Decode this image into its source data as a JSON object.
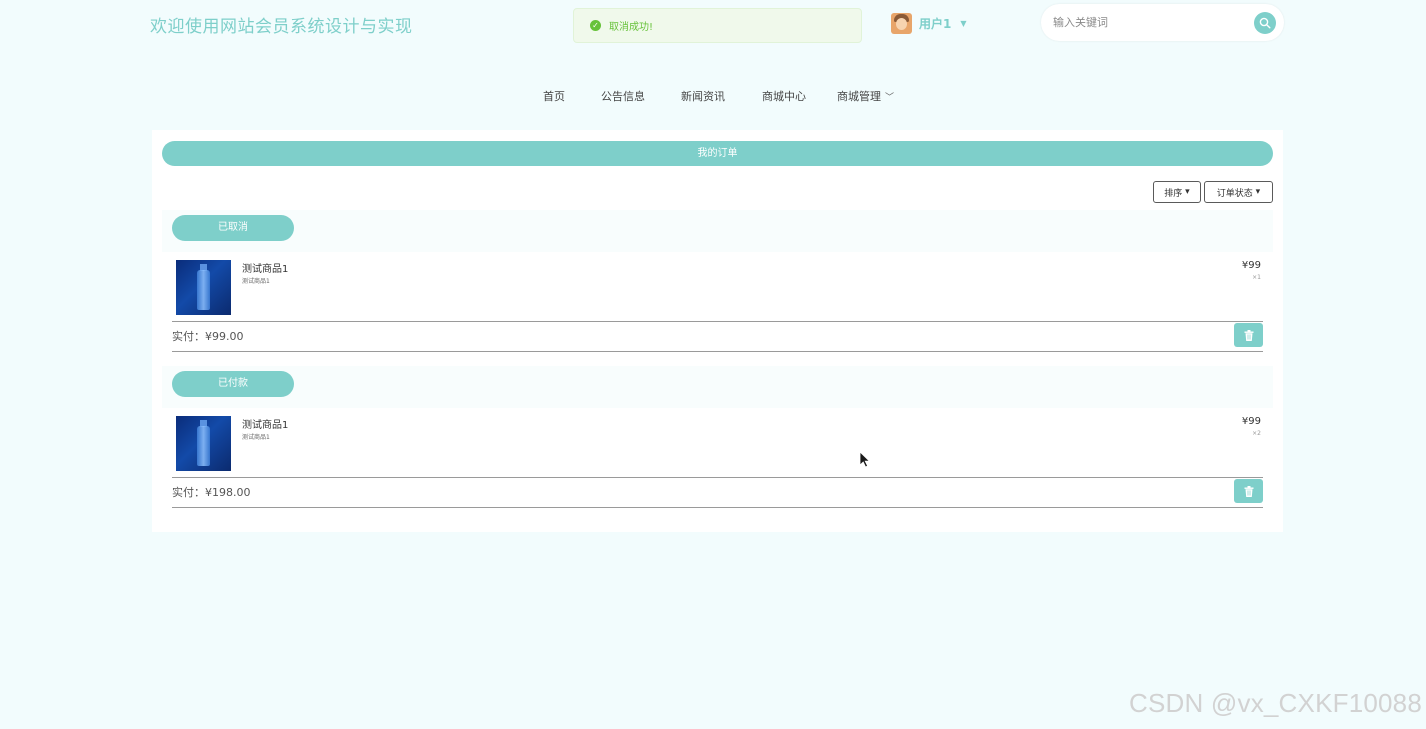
{
  "site": {
    "title": "欢迎使用网站会员系统设计与实现"
  },
  "toast": {
    "message": "取消成功!",
    "icon": "check-circle-icon",
    "color": "#67c23a"
  },
  "user": {
    "name": "用户1"
  },
  "search": {
    "placeholder": "输入关键词",
    "icon": "search-icon"
  },
  "nav": {
    "items": [
      {
        "label": "首页"
      },
      {
        "label": "公告信息"
      },
      {
        "label": "新闻资讯"
      },
      {
        "label": "商城中心"
      },
      {
        "label": "商城管理",
        "has_dropdown": true
      }
    ]
  },
  "main": {
    "title": "我的订单",
    "filters": {
      "sort": "排序",
      "status": "订单状态"
    },
    "orders": [
      {
        "status": "已取消",
        "product_name": "测试商品1",
        "product_sub": "测试商品1",
        "price": "¥99",
        "qty": "×1",
        "paid_label": "实付：",
        "paid_amount": "¥99.00"
      },
      {
        "status": "已付款",
        "product_name": "测试商品1",
        "product_sub": "测试商品1",
        "price": "¥99",
        "qty": "×2",
        "paid_label": "实付：",
        "paid_amount": "¥198.00"
      }
    ]
  },
  "theme": {
    "accent": "#7ecfca",
    "background": "#f2fcfd"
  },
  "watermark": "CSDN @vx_CXKF10088"
}
